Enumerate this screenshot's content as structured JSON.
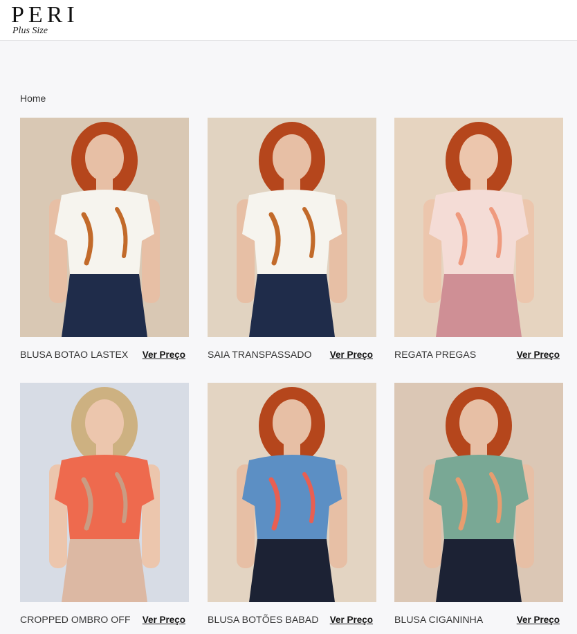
{
  "header": {
    "logo_main": "PERI",
    "logo_sub": "Plus Size"
  },
  "breadcrumb": {
    "home": "Home"
  },
  "products": [
    {
      "name": "BLUSA BOTAO LASTEX",
      "price_link": "Ver Preço",
      "colors": {
        "bg": "#d9c8b4",
        "hair": "#b5461c",
        "skin": "#e7bfa5",
        "top": "#f6f4ee",
        "bottom": "#1f2c4a",
        "accent": "#c26a2a"
      }
    },
    {
      "name": "SAIA TRANSPASSADO",
      "price_link": "Ver Preço",
      "colors": {
        "bg": "#e1d3c1",
        "hair": "#b5461c",
        "skin": "#e7bfa5",
        "top": "#f6f4ee",
        "bottom": "#1f2c4a",
        "accent": "#c26a2a"
      }
    },
    {
      "name": "REGATA PREGAS",
      "price_link": "Ver Preço",
      "colors": {
        "bg": "#e6d4c0",
        "hair": "#b5461c",
        "skin": "#ecc6ad",
        "top": "#f4dcd6",
        "bottom": "#cf8f95",
        "accent": "#ef9a7e"
      }
    },
    {
      "name": "CROPPED OMBRO OFF",
      "price_link": "Ver Preço",
      "colors": {
        "bg": "#d7dce5",
        "hair": "#cdb181",
        "skin": "#ecc6ad",
        "top": "#ee6a4e",
        "bottom": "#dcb8a3",
        "accent": "#c99c83"
      }
    },
    {
      "name": "BLUSA BOTÕES BABAD",
      "price_link": "Ver Preço",
      "colors": {
        "bg": "#e3d4c2",
        "hair": "#b5461c",
        "skin": "#e7bfa5",
        "top": "#5c8fc4",
        "bottom": "#1c2234",
        "accent": "#e85f52"
      }
    },
    {
      "name": "BLUSA CIGANINHA",
      "price_link": "Ver Preço",
      "colors": {
        "bg": "#dbc7b5",
        "hair": "#b5461c",
        "skin": "#e7bfa5",
        "top": "#79a895",
        "bottom": "#1c2234",
        "accent": "#e89d6f"
      }
    }
  ]
}
